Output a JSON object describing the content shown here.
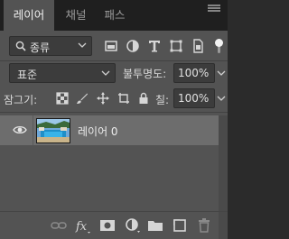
{
  "tabs": [
    {
      "label": "레이어",
      "active": true
    },
    {
      "label": "채널",
      "active": false
    },
    {
      "label": "패스",
      "active": false
    }
  ],
  "filter": {
    "kind": "종류",
    "icons": [
      "pixel-layer-filter-icon",
      "adjustment-layer-filter-icon",
      "type-layer-filter-icon",
      "shape-layer-filter-icon",
      "smart-object-filter-icon"
    ],
    "toggle_on": true
  },
  "blend": {
    "mode": "표준",
    "opacity_label": "불투명도:",
    "opacity_value": "100%"
  },
  "locks": {
    "label": "잠그기:",
    "icons": [
      "lock-transparent-pixels-icon",
      "lock-image-pixels-icon",
      "lock-position-icon",
      "prevent-auto-nesting-icon",
      "lock-all-icon"
    ],
    "fill_label": "칠:",
    "fill_value": "100%"
  },
  "layers": [
    {
      "name": "레이어 0",
      "visible": true,
      "selected": true
    }
  ],
  "bottom_icons": [
    "link-layers-icon",
    "fx-icon",
    "layer-mask-icon",
    "adjustment-layer-icon",
    "group-folder-icon",
    "new-layer-icon",
    "trash-icon"
  ],
  "colors": {
    "panel": "#535353",
    "tabbar": "#1f1f1f",
    "selected_row": "#6d6d6d",
    "field": "#3c3c3c"
  }
}
